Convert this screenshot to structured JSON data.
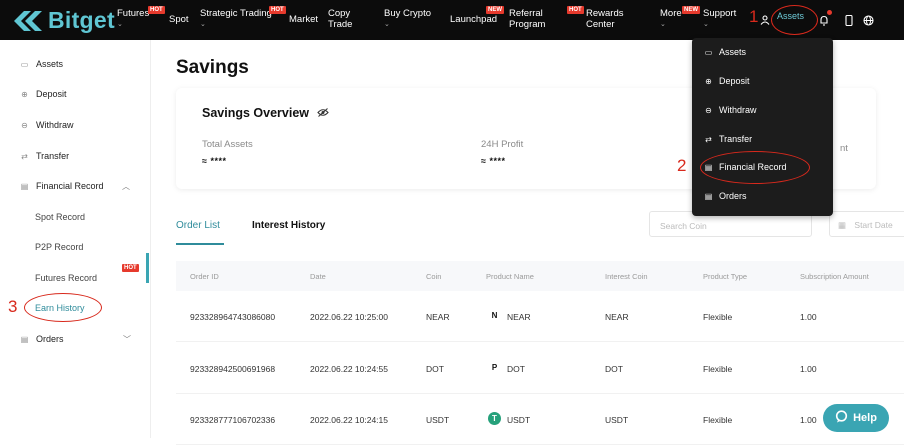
{
  "brand": {
    "name": "Bitget"
  },
  "nav": {
    "futures": "Futures",
    "futures_badge": "HOT",
    "spot": "Spot",
    "strategic": "Strategic Trading",
    "strategic_badge": "HOT",
    "market": "Market",
    "copy1": "Copy",
    "copy2": "Trade",
    "buy_crypto": "Buy Crypto",
    "launchpad": "Launchpad",
    "launchpad_badge": "NEW",
    "referral1": "Referral",
    "referral2": "Program",
    "rewards_badge": "HOT",
    "rewards1": "Rewards",
    "rewards2": "Center",
    "more": "More",
    "more_badge": "NEW",
    "support": "Support",
    "assets": "Assets",
    "chevron": "⌄"
  },
  "annotations": {
    "n1": "1",
    "n2": "2",
    "n3": "3"
  },
  "dropdown": {
    "items": [
      "Assets",
      "Deposit",
      "Withdraw",
      "Transfer",
      "Financial Record",
      "Orders"
    ]
  },
  "sidebar": {
    "items": [
      "Assets",
      "Deposit",
      "Withdraw",
      "Transfer",
      "Financial Record"
    ],
    "sub_items": [
      "Spot Record",
      "P2P Record",
      "Futures Record",
      "Earn History"
    ],
    "futures_badge": "HOT",
    "orders": "Orders"
  },
  "page": {
    "title": "Savings"
  },
  "overview": {
    "title": "Savings Overview",
    "total_assets_label": "Total Assets",
    "total_assets_value": "≈ ****",
    "profit_label": "24H Profit",
    "profit_value": "≈ ****",
    "third_label_partial": "nt"
  },
  "tabs": {
    "order_list": "Order List",
    "interest_history": "Interest History"
  },
  "filters": {
    "search_placeholder": "Search Coin",
    "start_date": "Start Date"
  },
  "table": {
    "headers": [
      "Order ID",
      "Date",
      "Coin",
      "Product Name",
      "Interest Coin",
      "Product Type",
      "Subscription Amount"
    ],
    "rows": [
      {
        "order_id": "923328964743086080",
        "date": "2022.06.22 10:25:00",
        "coin": "NEAR",
        "product": "NEAR",
        "interest_coin": "NEAR",
        "type": "Flexible",
        "amount": "1.00"
      },
      {
        "order_id": "923328942500691968",
        "date": "2022.06.22 10:24:55",
        "coin": "DOT",
        "product": "DOT",
        "interest_coin": "DOT",
        "type": "Flexible",
        "amount": "1.00"
      },
      {
        "order_id": "923328777106702336",
        "date": "2022.06.22 10:24:15",
        "coin": "USDT",
        "product": "USDT",
        "interest_coin": "USDT",
        "type": "Flexible",
        "amount": "1.00"
      }
    ]
  },
  "help": {
    "label": "Help"
  },
  "colors": {
    "accent": "#2f8c9b",
    "annotation": "#d8291c",
    "nav_bg": "#0c0c0c"
  }
}
